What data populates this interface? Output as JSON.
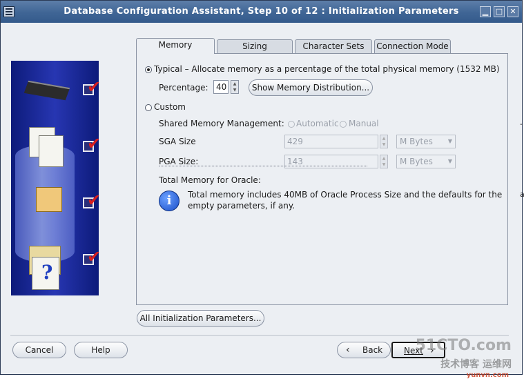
{
  "window": {
    "title": "Database Configuration Assistant, Step 10 of 12 : Initialization Parameters",
    "min": "▁",
    "max": "□",
    "close": "✕"
  },
  "tabs": [
    {
      "label": "Memory",
      "active": true
    },
    {
      "label": "Sizing",
      "active": false
    },
    {
      "label": "Character Sets",
      "active": false
    },
    {
      "label": "Connection Mode",
      "active": false
    }
  ],
  "memory": {
    "typical_label": "Typical – Allocate memory as a percentage of the total physical memory (1532 MB)",
    "percentage_label": "Percentage:",
    "percentage_value": "40",
    "show_distribution_button": "Show Memory Distribution...",
    "custom_label": "Custom",
    "shared_mem_label": "Shared Memory Management:",
    "automatic_label": "Automatic",
    "manual_label": "Manual",
    "sga_label": "SGA Size",
    "sga_value": "429",
    "sga_unit": "M Bytes",
    "pga_label": "PGA Size:",
    "pga_value": "143",
    "pga_unit": "M Bytes",
    "total_label": "Total Memory for Oracle:",
    "info_line1": "Total memory includes 40MB of Oracle Process Size and the defaults for the",
    "info_line2": "empty parameters, if any.",
    "info_glyph": "i"
  },
  "all_params_button": "All Initialization Parameters...",
  "footer": {
    "cancel": "Cancel",
    "help": "Help",
    "back": "Back",
    "next": "Next",
    "back_glyph": "‹",
    "next_glyph": "›"
  },
  "side_question": "?",
  "side_checkmark": "✔",
  "watermark": {
    "line1": "51CTO.com",
    "line2": "技术博客 运维网",
    "line3": "yunvn.com"
  },
  "edge_text": {
    "dash": "-",
    "a": "a"
  }
}
